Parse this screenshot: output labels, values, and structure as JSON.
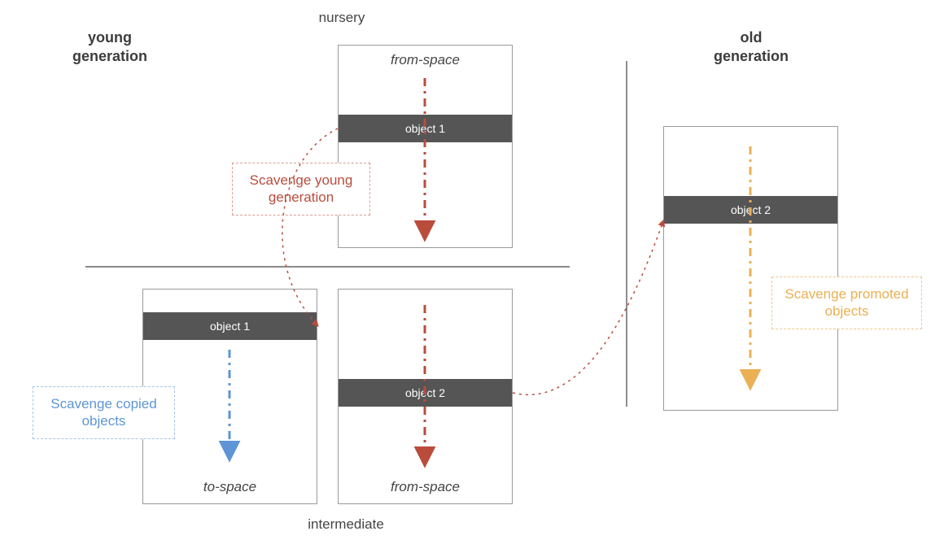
{
  "headings": {
    "young": "young\ngeneration",
    "old": "old\ngeneration"
  },
  "labels": {
    "nursery": "nursery",
    "intermediate": "intermediate",
    "from_space": "from-space",
    "to_space": "to-space"
  },
  "objects": {
    "object1": "object 1",
    "object2": "object 2"
  },
  "callouts": {
    "young": "Scavenge young generation",
    "copied": "Scavenge copied objects",
    "promoted": "Scavenge promoted objects"
  },
  "colors": {
    "red": "#ba4c3c",
    "blue": "#5d95d6",
    "orange": "#eab054",
    "bar": "#555555"
  }
}
